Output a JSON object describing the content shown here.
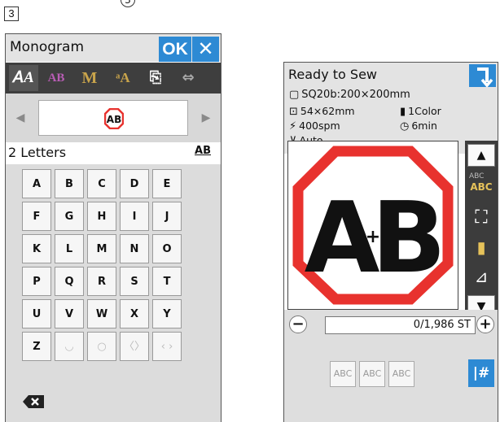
{
  "step_label": "3",
  "callout_label": "3",
  "monogram": {
    "title": "Monogram",
    "ok_label": "OK",
    "close_icon": "close-icon",
    "letters_count_label": "2 Letters",
    "preview_text": "AB",
    "letter_case_label": "AB",
    "keys": [
      [
        "A",
        "B",
        "C",
        "D",
        "E"
      ],
      [
        "F",
        "G",
        "H",
        "I",
        "J"
      ],
      [
        "K",
        "L",
        "M",
        "N",
        "O"
      ],
      [
        "P",
        "Q",
        "R",
        "S",
        "T"
      ],
      [
        "U",
        "V",
        "W",
        "X",
        "Y"
      ],
      [
        "Z",
        "◡",
        "○",
        "〈〉",
        "‹ ›"
      ]
    ]
  },
  "ready": {
    "title": "Ready to Sew",
    "hoop": "SQ20b:200×200mm",
    "size": "54×62mm",
    "colors": "1Color",
    "speed": "400spm",
    "time": "6min",
    "tension": "Auto",
    "stitch_count": "0/1,986 ST",
    "abc_buttons": [
      "ABC",
      "ABC",
      "ABC"
    ],
    "hash_label": "|#",
    "design_letters": [
      "A",
      "+",
      "B"
    ],
    "colors_map": {
      "accent": "#2d8ad4",
      "border_red": "#e8322e"
    }
  }
}
